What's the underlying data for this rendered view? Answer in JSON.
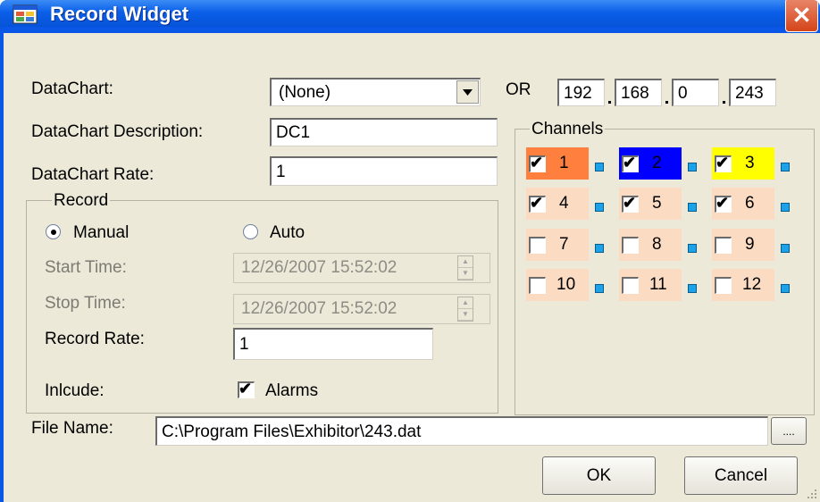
{
  "window": {
    "title": "Record Widget",
    "close_symbol": "✕"
  },
  "datachart": {
    "label": "DataChart:",
    "selected": "(None)",
    "or_label": "OR",
    "ip": [
      "192",
      "168",
      "0",
      "243"
    ]
  },
  "description": {
    "label": "DataChart Description:",
    "value": "DC1"
  },
  "rate": {
    "label": "DataChart Rate:",
    "value": "1"
  },
  "record": {
    "legend": "Record",
    "manual_label": "Manual",
    "auto_label": "Auto",
    "mode": "Manual",
    "start_label": "Start Time:",
    "start_value": "12/26/2007 15:52:02",
    "stop_label": "Stop Time:",
    "stop_value": "12/26/2007 15:52:02",
    "rate_label": "Record Rate:",
    "rate_value": "1",
    "include_label": "Inlcude:",
    "alarms_label": "Alarms",
    "alarms_checked": true
  },
  "channels": {
    "legend": "Channels",
    "items": [
      {
        "label": "1",
        "checked": true,
        "color": "#ff7f3f"
      },
      {
        "label": "2",
        "checked": true,
        "color": "#0000ff"
      },
      {
        "label": "3",
        "checked": true,
        "color": "#ffff00"
      },
      {
        "label": "4",
        "checked": true,
        "color": "#fbdcc2"
      },
      {
        "label": "5",
        "checked": true,
        "color": "#fbdcc2"
      },
      {
        "label": "6",
        "checked": true,
        "color": "#fbdcc2"
      },
      {
        "label": "7",
        "checked": false,
        "color": "#fbdcc2"
      },
      {
        "label": "8",
        "checked": false,
        "color": "#fbdcc2"
      },
      {
        "label": "9",
        "checked": false,
        "color": "#fbdcc2"
      },
      {
        "label": "10",
        "checked": false,
        "color": "#fbdcc2"
      },
      {
        "label": "11",
        "checked": false,
        "color": "#fbdcc2"
      },
      {
        "label": "12",
        "checked": false,
        "color": "#fbdcc2"
      }
    ]
  },
  "file": {
    "label": "File Name:",
    "value": "C:\\Program Files\\Exhibitor\\243.dat",
    "browse_label": "...."
  },
  "buttons": {
    "ok": "OK",
    "cancel": "Cancel"
  },
  "check_glyph": "✔"
}
